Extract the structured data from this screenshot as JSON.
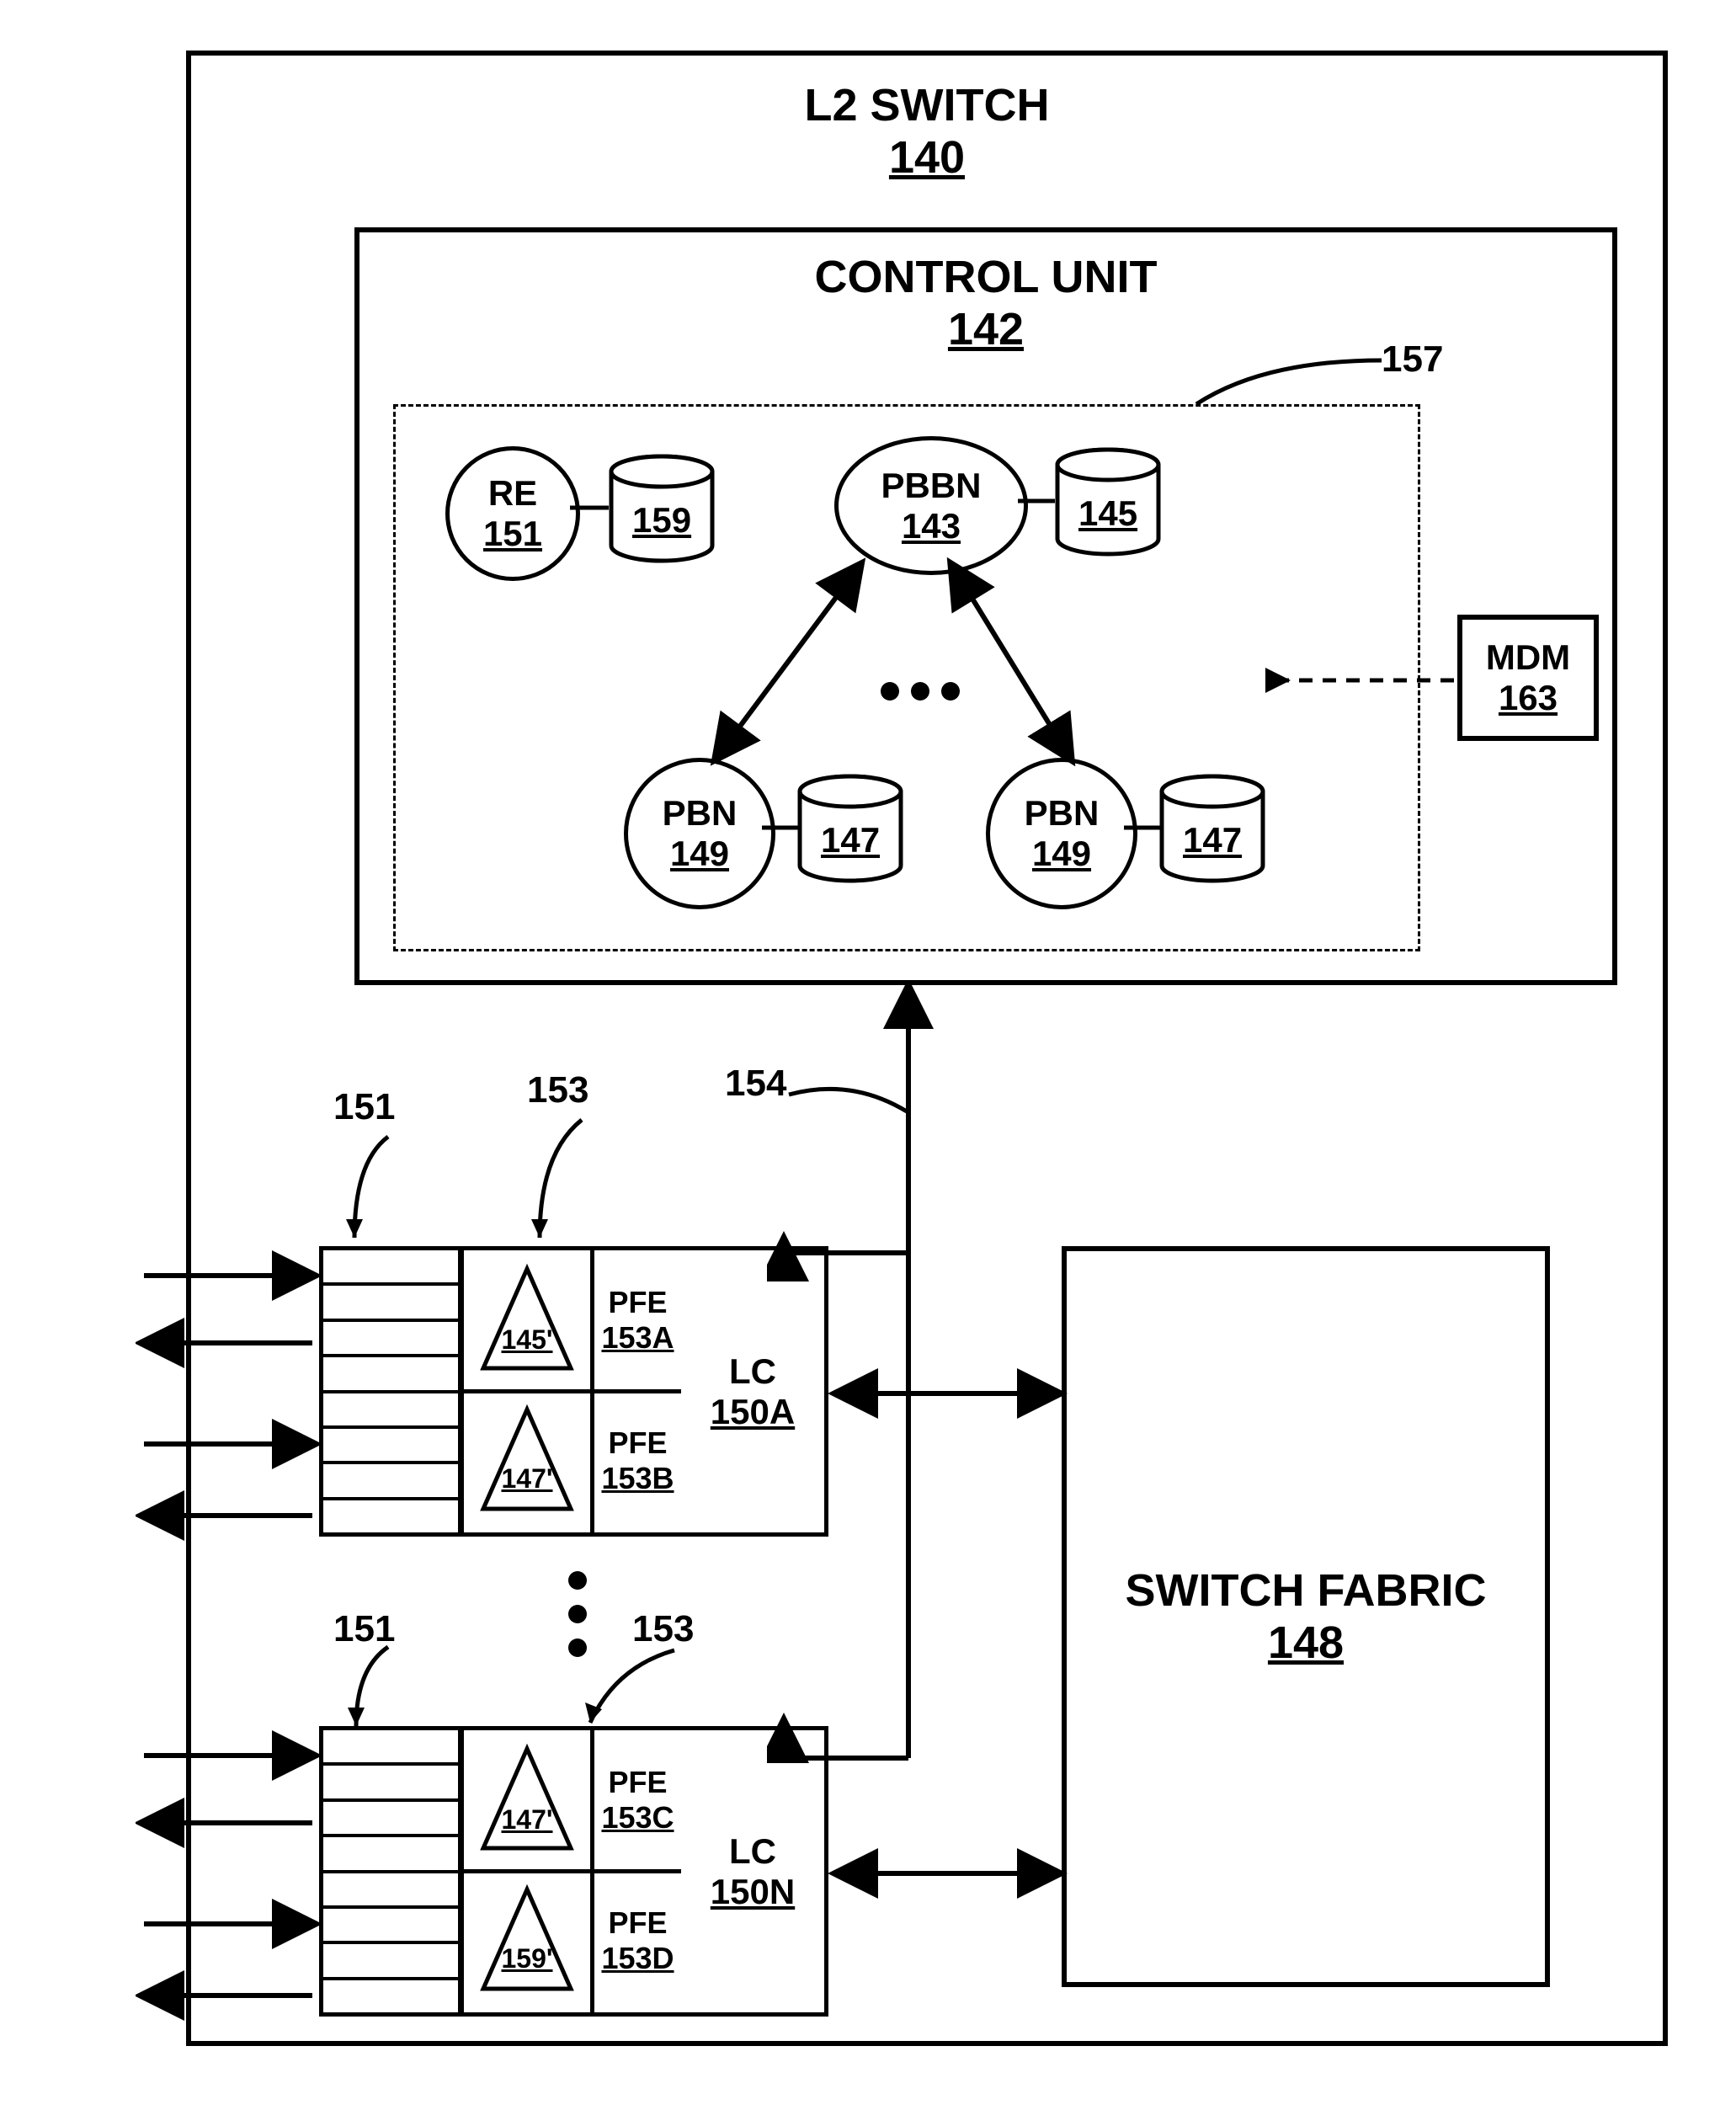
{
  "switch": {
    "title": "L2 SWITCH",
    "num": "140"
  },
  "cu": {
    "title": "CONTROL UNIT",
    "num": "142"
  },
  "dashed_label": "157",
  "mdm": {
    "title": "MDM",
    "num": "163"
  },
  "re": {
    "title": "RE",
    "num": "151",
    "db_num": "159"
  },
  "pbbn": {
    "title": "PBBN",
    "num": "143",
    "db_num": "145"
  },
  "pbn1": {
    "title": "PBN",
    "num": "149",
    "db_num": "147"
  },
  "pbn2": {
    "title": "PBN",
    "num": "149",
    "db_num": "147"
  },
  "leads": {
    "top_left": "151",
    "top_mid": "153",
    "top_right": "154",
    "bot_left": "151",
    "bot_mid": "153"
  },
  "pfe_a": {
    "tri": "145'",
    "title": "PFE",
    "num": "153A"
  },
  "pfe_b": {
    "tri": "147'",
    "title": "PFE",
    "num": "153B"
  },
  "pfe_c": {
    "tri": "147'",
    "title": "PFE",
    "num": "153C"
  },
  "pfe_d": {
    "tri": "159'",
    "title": "PFE",
    "num": "153D"
  },
  "lc_a": {
    "title": "LC",
    "num": "150A"
  },
  "lc_n": {
    "title": "LC",
    "num": "150N"
  },
  "sf": {
    "title": "SWITCH FABRIC",
    "num": "148"
  }
}
